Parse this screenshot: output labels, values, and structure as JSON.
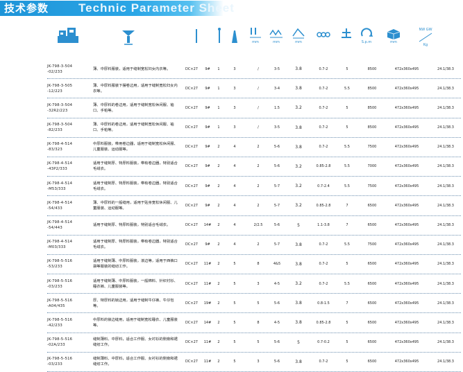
{
  "title": {
    "cn": "技术参数",
    "en": "Technic Parameter Sheet"
  },
  "header_units": {
    "mm_a": "mm",
    "mm_b": "mm",
    "mm_c": "mm",
    "spm": "S.p.m",
    "mm_dim": "mm",
    "nw_gw": "NW GW",
    "kg": "Kg"
  },
  "rows": [
    {
      "model": [
        "JK-798-3-504",
        "-02/233"
      ],
      "desc": "薄、中厚料服装，适用于缝制宽松妇女内衣等。",
      "speed": "DC×27",
      "needle": "9#",
      "n1": "1",
      "n2": "3",
      "n3": "/",
      "n4": "3-5",
      "n5": "3.8",
      "n6": "0.7-2",
      "n7": "5",
      "spm": "8500",
      "dim": "472x360x495",
      "wt": "24.1/38.3"
    },
    {
      "model": [
        "JK-798-3-505",
        "-12/223"
      ],
      "desc": "薄、中厚料服装下摆卷边用，适用于缝制宽松妇女内衣等。",
      "speed": "DC×27",
      "needle": "9#",
      "n1": "1",
      "n2": "3",
      "n3": "/",
      "n4": "3-4",
      "n5": "3.8",
      "n6": "0.7-2",
      "n7": "5.5",
      "spm": "8500",
      "dim": "472x360x495",
      "wt": "24.1/38.3"
    },
    {
      "model": [
        "JK-798-3-504",
        "-32R2/223"
      ],
      "desc": "薄、中厚料的卷边用，适用于缝制宽松休闲服、袖口、手帕等。",
      "speed": "DC×27",
      "needle": "9#",
      "n1": "1",
      "n2": "3",
      "n3": "/",
      "n4": "1.5",
      "n5": "3.2",
      "n6": "0.7-2",
      "n7": "5",
      "spm": "8500",
      "dim": "472x360x495",
      "wt": "24.1/38.3"
    },
    {
      "model": [
        "JK-798-3-504",
        "-82/233"
      ],
      "desc": "薄、中厚料的卷边用，适用于缝制宽松休闲服、袖口、手帕等。",
      "speed": "DC×27",
      "needle": "9#",
      "n1": "1",
      "n2": "3",
      "n3": "/",
      "n4": "3-5",
      "n5": "3.8",
      "n6": "0.7-2",
      "n7": "5",
      "spm": "8500",
      "dim": "472x360x495",
      "wt": "24.1/38.3"
    },
    {
      "model": [
        "JK-798-4-514",
        "-83/323"
      ],
      "desc": "中厚料服装，带用卷边器，适用于缝制宽松休闲服、儿童服装、运动服等。",
      "speed": "DC×27",
      "needle": "9#",
      "n1": "2",
      "n2": "4",
      "n3": "2",
      "n4": "5-6",
      "n5": "3.8",
      "n6": "0.7-2",
      "n7": "5.5",
      "spm": "7500",
      "dim": "472x360x495",
      "wt": "24.1/38.3"
    },
    {
      "model": [
        "JK-798-4-514",
        "-43P2/333"
      ],
      "desc": "适用于缝制厚、特厚料服装，带有卷边器，特别适合毛绒衣。",
      "speed": "DC×27",
      "needle": "9#",
      "n1": "2",
      "n2": "4",
      "n3": "2",
      "n4": "5-6",
      "n5": "3.2",
      "n6": "0.85-2.8",
      "n7": "5.5",
      "spm": "7000",
      "dim": "472x360x495",
      "wt": "24.1/38.3"
    },
    {
      "model": [
        "JK-798-4-514",
        "-M53/333"
      ],
      "desc": "适用于缝制厚、特厚料服装，带有卷边器，特别适合毛绒衣。",
      "speed": "DC×27",
      "needle": "9#",
      "n1": "2",
      "n2": "4",
      "n3": "2",
      "n4": "5-7",
      "n5": "3.2",
      "n6": "0.7-2.4",
      "n7": "5.5",
      "spm": "7500",
      "dim": "472x360x495",
      "wt": "24.1/38.3"
    },
    {
      "model": [
        "JK-798-4-514",
        "-54/433"
      ],
      "desc": "薄、中厚料的一般缝用，适用于贴身宽松休闲服、儿童服装、运动服等。",
      "speed": "DC×27",
      "needle": "9#",
      "n1": "2",
      "n2": "4",
      "n3": "2",
      "n4": "5-7",
      "n5": "3.2",
      "n6": "0.85-2.8",
      "n7": "7",
      "spm": "6500",
      "dim": "472x360x495",
      "wt": "24.1/38.3"
    },
    {
      "model": [
        "JK-798-4-514",
        "-54/443"
      ],
      "desc": "适用于缝制厚、特厚料服装，特别适合毛绒衣。",
      "speed": "DC×27",
      "needle": "14#",
      "n1": "2",
      "n2": "4",
      "n3": "2/2.5",
      "n4": "5-6",
      "n5": "5",
      "n6": "1.1-3.8",
      "n7": "7",
      "spm": "6500",
      "dim": "472x360x495",
      "wt": "24.1/38.3"
    },
    {
      "model": [
        "JK-798-4-514",
        "-M03/333"
      ],
      "desc": "适用于缝制厚、特厚料服装，带有卷边器，特别适合毛绒衣。",
      "speed": "DC×27",
      "needle": "9#",
      "n1": "2",
      "n2": "4",
      "n3": "2",
      "n4": "5-7",
      "n5": "3.8",
      "n6": "0.7-2",
      "n7": "5.5",
      "spm": "7500",
      "dim": "472x360x495",
      "wt": "24.1/38.3"
    },
    {
      "model": [
        "JK-798-5-516",
        "-53/233"
      ],
      "desc": "适用于缝制薄、中厚料服装，滚边等，适用于西裤口袋等服装的缝纫工作。",
      "speed": "DC×27",
      "needle": "11#",
      "n1": "2",
      "n2": "5",
      "n3": "8",
      "n4": "4&5",
      "n5": "3.8",
      "n6": "0.7-2",
      "n7": "5",
      "spm": "6500",
      "dim": "472x360x495",
      "wt": "24.1/38.3"
    },
    {
      "model": [
        "JK-798-5-516",
        "-03/233"
      ],
      "desc": "适用于缝制薄、中厚料服装，一般棉料、针织衬衫、睡衣裤、儿童服装等。",
      "speed": "DC×27",
      "needle": "11#",
      "n1": "2",
      "n2": "5",
      "n3": "3",
      "n4": "4-5",
      "n5": "3.2",
      "n6": "0.7-2",
      "n7": "5.5",
      "spm": "6500",
      "dim": "472x360x495",
      "wt": "24.1/38.3"
    },
    {
      "model": [
        "JK-798-5-516",
        "-A04/435"
      ],
      "desc": "厚、特厚料的锁边用，适用于缝制牛仔裤、牛仔包等。",
      "speed": "DC×27",
      "needle": "19#",
      "n1": "2",
      "n2": "5",
      "n3": "5",
      "n4": "5-6",
      "n5": "3.8",
      "n6": "0.8-1.5",
      "n7": "7",
      "spm": "6500",
      "dim": "472x360x495",
      "wt": "24.1/38.3"
    },
    {
      "model": [
        "JK-798-5-516",
        "-42/233"
      ],
      "desc": "中厚料的锁边缝用，适用于缝制宽松睡衣、儿童服装等。",
      "speed": "DC×27",
      "needle": "14#",
      "n1": "2",
      "n2": "5",
      "n3": "8",
      "n4": "4-5",
      "n5": "3.8",
      "n6": "0.85-2.8",
      "n7": "5",
      "spm": "6500",
      "dim": "472x360x495",
      "wt": "24.1/38.3"
    },
    {
      "model": [
        "JK-798-5-516",
        "-02A/233"
      ],
      "desc": "缝制薄料、中厚料，适合工作服、女衬衫的侧旁和裙缝纫工作。",
      "speed": "DC×27",
      "needle": "11#",
      "n1": "2",
      "n2": "5",
      "n3": "5",
      "n4": "5-6",
      "n5": "5",
      "n6": "0.7-0.2",
      "n7": "5",
      "spm": "6500",
      "dim": "472x360x495",
      "wt": "24.1/38.3"
    },
    {
      "model": [
        "JK-798-5-516",
        "-03/233"
      ],
      "desc": "缝制薄料、中厚料，适合工作服、女衬衫的侧旁和裙缝纫工作。",
      "speed": "DC×27",
      "needle": "11#",
      "n1": "2",
      "n2": "5",
      "n3": "3",
      "n4": "5-6",
      "n5": "3.8",
      "n6": "0.7-2",
      "n7": "5",
      "spm": "6500",
      "dim": "472x360x495",
      "wt": "24.1/38.3"
    }
  ],
  "colors": {
    "accent": "#1e94d8",
    "icon": "#2c8fcf",
    "row_line": "#6c8fb0"
  }
}
